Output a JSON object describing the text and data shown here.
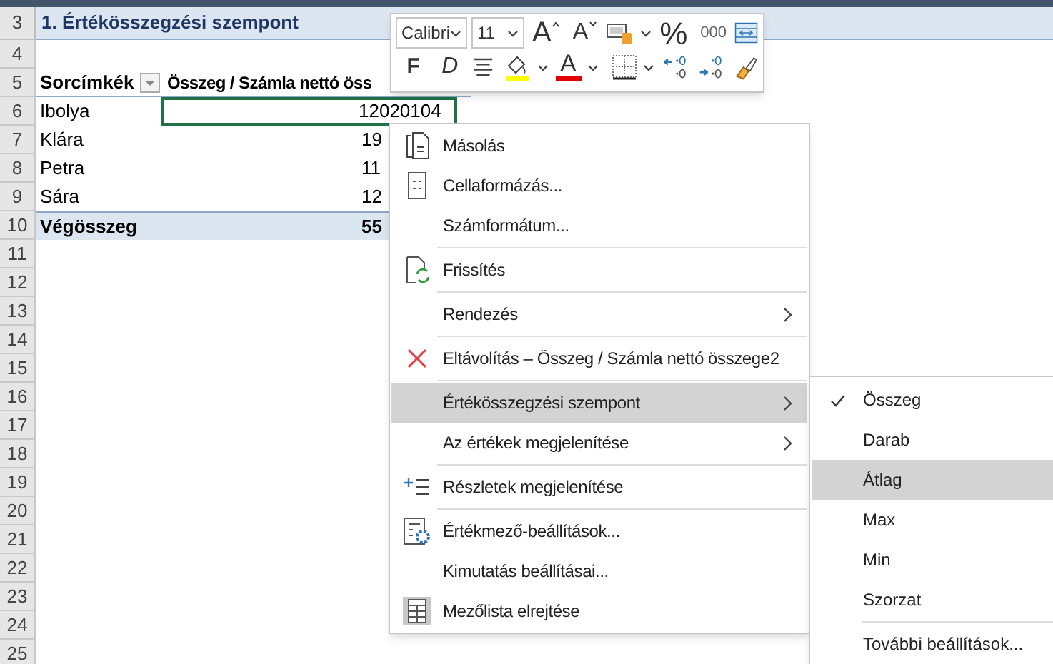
{
  "sheet": {
    "title_row": {
      "row": "3",
      "text": "1. Értékösszegzési szempont"
    },
    "rows": [
      {
        "row": "4",
        "kind": "empty",
        "selected": false
      },
      {
        "row": "5",
        "kind": "header",
        "col_a": "Sorcímkék",
        "col_b": "Összeg / Számla nettó öss",
        "selected": false
      },
      {
        "row": "6",
        "kind": "data",
        "col_a": "Ibolya",
        "col_b": "12020104",
        "selected": true
      },
      {
        "row": "7",
        "kind": "data",
        "col_a": "Klára",
        "col_b": "19",
        "selected": false
      },
      {
        "row": "8",
        "kind": "data",
        "col_a": "Petra",
        "col_b": "11",
        "selected": false
      },
      {
        "row": "9",
        "kind": "data",
        "col_a": "Sára",
        "col_b": "12",
        "selected": false
      },
      {
        "row": "10",
        "kind": "total",
        "col_a": "Végösszeg",
        "col_b": "55",
        "selected": false
      },
      {
        "row": "11",
        "kind": "empty",
        "selected": false
      },
      {
        "row": "12",
        "kind": "empty",
        "selected": false
      },
      {
        "row": "13",
        "kind": "empty",
        "selected": false
      },
      {
        "row": "14",
        "kind": "empty",
        "selected": false
      },
      {
        "row": "15",
        "kind": "empty",
        "selected": false
      },
      {
        "row": "16",
        "kind": "empty",
        "selected": false
      },
      {
        "row": "17",
        "kind": "empty",
        "selected": false
      },
      {
        "row": "18",
        "kind": "empty",
        "selected": false
      },
      {
        "row": "19",
        "kind": "empty",
        "selected": false
      },
      {
        "row": "20",
        "kind": "empty",
        "selected": false
      },
      {
        "row": "21",
        "kind": "empty",
        "selected": false
      },
      {
        "row": "22",
        "kind": "empty",
        "selected": false
      },
      {
        "row": "23",
        "kind": "empty",
        "selected": false
      },
      {
        "row": "24",
        "kind": "empty",
        "selected": false
      },
      {
        "row": "25",
        "kind": "empty",
        "selected": false
      }
    ]
  },
  "mini_toolbar": {
    "font_name": "Calibri",
    "font_size": "11",
    "row_1": [
      {
        "kind": "grow",
        "label": "A"
      },
      {
        "kind": "shrink",
        "label": "A"
      },
      {
        "kind": "styles"
      },
      {
        "kind": "percent",
        "label": "%"
      },
      {
        "kind": "thousands",
        "label": "000"
      },
      {
        "kind": "merge"
      }
    ],
    "row_2": [
      {
        "kind": "bold",
        "label": "F"
      },
      {
        "kind": "italic",
        "label": "D"
      },
      {
        "kind": "align"
      },
      {
        "kind": "fill"
      },
      {
        "kind": "fontcolor",
        "label": "A"
      },
      {
        "kind": "borders"
      },
      {
        "kind": "decdown"
      },
      {
        "kind": "decup"
      },
      {
        "kind": "painter"
      }
    ]
  },
  "context_menu": [
    {
      "kind": "copy",
      "label": "Másolás",
      "selected": false,
      "divider_after": false
    },
    {
      "kind": "format",
      "label": "Cellaformázás...",
      "selected": false,
      "divider_after": false
    },
    {
      "kind": "plain",
      "label": "Számformátum...",
      "selected": false,
      "divider_after": true
    },
    {
      "kind": "refresh",
      "label": "Frissítés",
      "selected": false,
      "divider_after": true
    },
    {
      "kind": "submenu",
      "label": "Rendezés",
      "selected": false,
      "divider_after": true
    },
    {
      "kind": "remove",
      "label": "Eltávolítás – Összeg / Számla nettó összege2",
      "selected": false,
      "divider_after": true
    },
    {
      "kind": "submenu",
      "label": "Értékösszegzési szempont",
      "selected": true,
      "divider_after": false
    },
    {
      "kind": "submenu",
      "label": "Az értékek megjelenítése",
      "selected": false,
      "divider_after": true
    },
    {
      "kind": "details",
      "label": "Részletek megjelenítése",
      "selected": false,
      "divider_after": true
    },
    {
      "kind": "settings",
      "label": "Értékmező-beállítások...",
      "selected": false,
      "divider_after": false
    },
    {
      "kind": "plain",
      "label": "Kimutatás beállításai...",
      "selected": false,
      "divider_after": false
    },
    {
      "kind": "fieldlist",
      "label": "Mezőlista elrejtése",
      "selected": false,
      "divider_after": false
    }
  ],
  "submenu": [
    {
      "label": "Összeg",
      "checked": true,
      "selected": false,
      "divider_after": false
    },
    {
      "label": "Darab",
      "checked": false,
      "selected": false,
      "divider_after": false
    },
    {
      "label": "Átlag",
      "checked": false,
      "selected": true,
      "divider_after": false
    },
    {
      "label": "Max",
      "checked": false,
      "selected": false,
      "divider_after": false
    },
    {
      "label": "Min",
      "checked": false,
      "selected": false,
      "divider_after": false
    },
    {
      "label": "Szorzat",
      "checked": false,
      "selected": false,
      "divider_after": true
    },
    {
      "label": "További beállítások...",
      "checked": false,
      "selected": false,
      "divider_after": false
    }
  ]
}
